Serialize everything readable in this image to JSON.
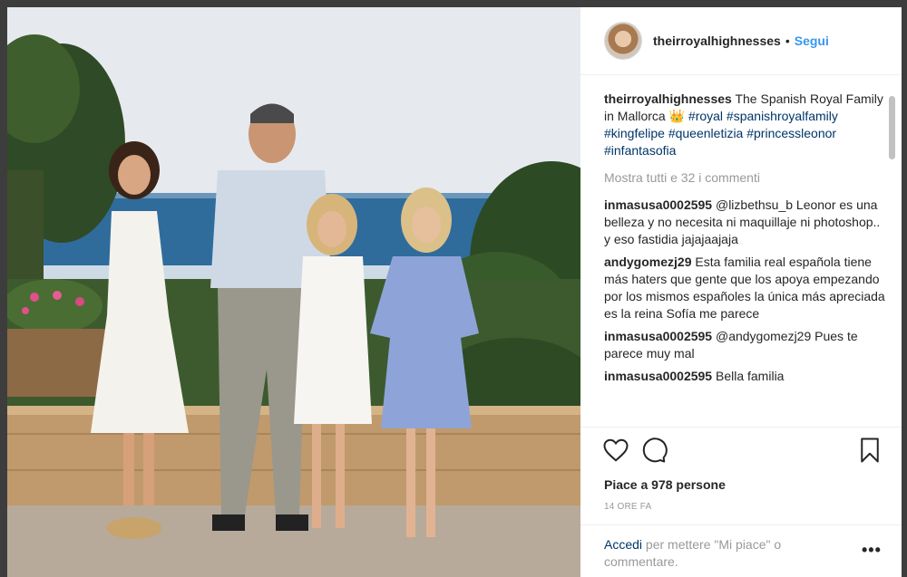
{
  "post": {
    "username": "theirroyalhighnesses",
    "dot": "•",
    "follow_label": "Segui",
    "caption_user": "theirroyalhighnesses",
    "caption_text": "The Spanish Royal Family in Mallorca 👑",
    "caption_tags": "#royal #spanishroyalfamily #kingfelipe #queenletizia #princessleonor #infantasofia",
    "view_all_comments": "Mostra tutti e 32 i commenti",
    "comments": [
      {
        "user": "inmasusa0002595",
        "text": "@lizbethsu_b Leonor es una belleza y no necesita ni maquillaje ni photoshop.. y eso fastidia jajajaajaja"
      },
      {
        "user": "andygomezj29",
        "text": "Esta familia real española tiene más haters que gente que los apoya empezando por los mismos españoles la única más apreciada es la reina Sofía me parece"
      },
      {
        "user": "inmasusa0002595",
        "text": "@andygomezj29 Pues te parece muy mal"
      },
      {
        "user": "inmasusa0002595",
        "text": "Bella familia"
      }
    ],
    "likes": "Piace a 978 persone",
    "time_ago": "14 ORE FA",
    "login_link": "Accedi",
    "login_text": "per mettere \"Mi piace\" o commentare.",
    "more_options": "•••"
  },
  "icons": {
    "like": "heart-icon",
    "comment": "speech-bubble-icon",
    "save": "bookmark-icon"
  },
  "colors": {
    "link_blue": "#3897f0",
    "hashtag": "#003569",
    "muted": "#999999"
  }
}
